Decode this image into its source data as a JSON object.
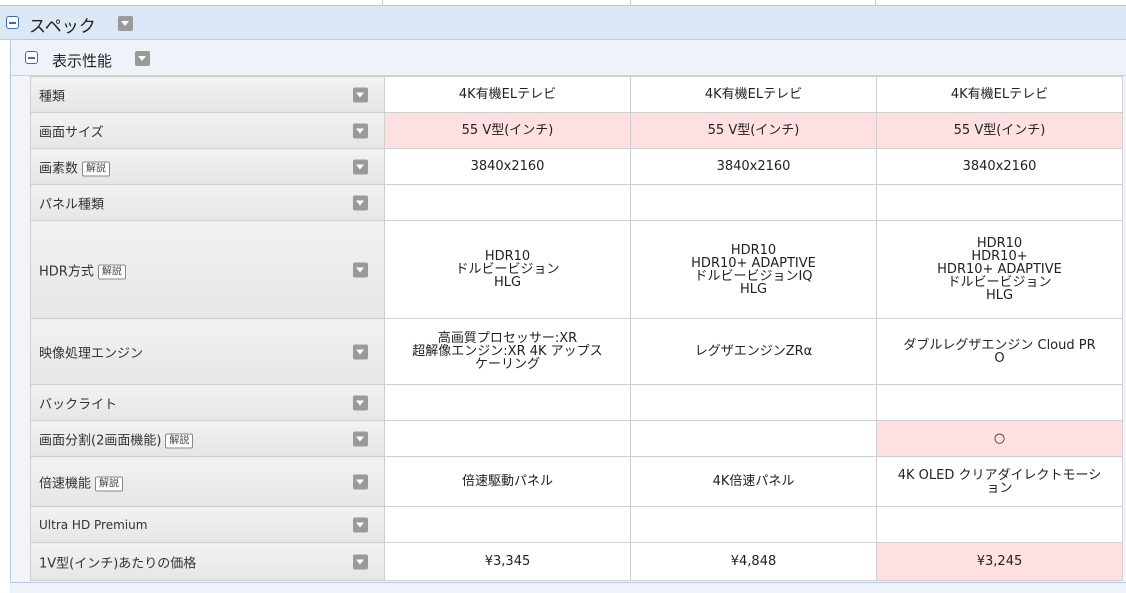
{
  "section": {
    "title": "スペック"
  },
  "subsection": {
    "title": "表示性能"
  },
  "kaisetsu_label": "解説",
  "rows": [
    {
      "label": "種類",
      "kaisetsu": false,
      "values": [
        "4K有機ELテレビ",
        "4K有機ELテレビ",
        "4K有機ELテレビ"
      ],
      "highlight": [
        false,
        false,
        false
      ]
    },
    {
      "label": "画面サイズ",
      "kaisetsu": false,
      "values": [
        "55 V型(インチ)",
        "55 V型(インチ)",
        "55 V型(インチ)"
      ],
      "highlight": [
        true,
        true,
        true
      ]
    },
    {
      "label": "画素数",
      "kaisetsu": true,
      "values": [
        "3840x2160",
        "3840x2160",
        "3840x2160"
      ],
      "highlight": [
        false,
        false,
        false
      ]
    },
    {
      "label": "パネル種類",
      "kaisetsu": false,
      "values": [
        "",
        "",
        ""
      ],
      "highlight": [
        false,
        false,
        false
      ]
    },
    {
      "label": "HDR方式",
      "kaisetsu": true,
      "values": [
        "HDR10\nドルビービジョン\nHLG",
        "HDR10\nHDR10+ ADAPTIVE\nドルビービジョンIQ\nHLG",
        "HDR10\nHDR10+\nHDR10+ ADAPTIVE\nドルビービジョン\nHLG"
      ],
      "highlight": [
        false,
        false,
        false
      ]
    },
    {
      "label": "映像処理エンジン",
      "kaisetsu": false,
      "values": [
        "高画質プロセッサー:XR\n超解像エンジン:XR 4K アップス\nケーリング",
        "レグザエンジンZRα",
        "ダブルレグザエンジン Cloud PR\nO"
      ],
      "highlight": [
        false,
        false,
        false
      ]
    },
    {
      "label": "バックライト",
      "kaisetsu": false,
      "values": [
        "",
        "",
        ""
      ],
      "highlight": [
        false,
        false,
        false
      ]
    },
    {
      "label": "画面分割(2画面機能)",
      "kaisetsu": true,
      "values": [
        "",
        "",
        "○"
      ],
      "highlight": [
        false,
        false,
        true
      ]
    },
    {
      "label": "倍速機能",
      "kaisetsu": true,
      "values": [
        "倍速駆動パネル",
        "4K倍速パネル",
        "4K OLED クリアダイレクトモーシ\nョン"
      ],
      "highlight": [
        false,
        false,
        false
      ]
    },
    {
      "label": "Ultra HD Premium",
      "kaisetsu": false,
      "values": [
        "",
        "",
        ""
      ],
      "highlight": [
        false,
        false,
        false
      ]
    },
    {
      "label": "1V型(インチ)あたりの価格",
      "kaisetsu": false,
      "values": [
        "¥3,345",
        "¥4,848",
        "¥3,245"
      ],
      "highlight": [
        false,
        false,
        true
      ]
    }
  ],
  "colors": {
    "header_bg": "#dde8f6",
    "highlight": "#ffe0e0",
    "label_bg": "#ececec",
    "icon": "#9a9a9a"
  }
}
